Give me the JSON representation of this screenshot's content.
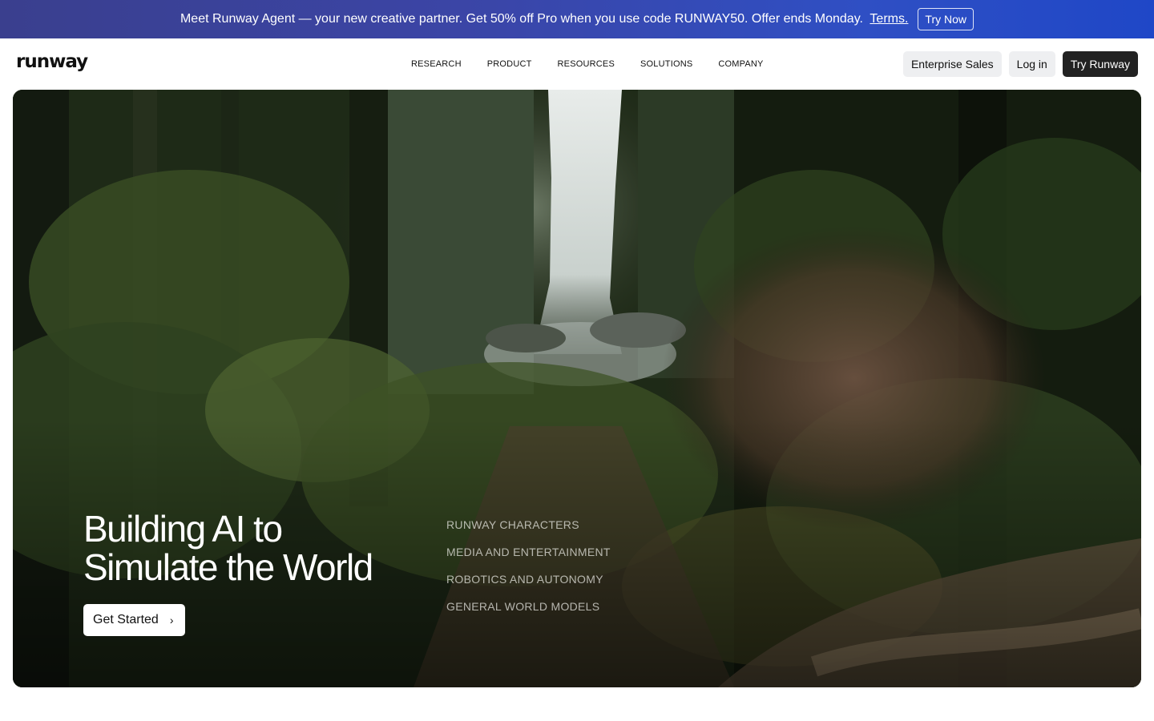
{
  "promo": {
    "text": "Meet Runway Agent — your new creative partner. Get 50% off Pro when you use code RUNWAY50. Offer ends Monday.",
    "terms_link": "Terms.",
    "cta": "Try Now"
  },
  "header": {
    "logo": "runway",
    "nav": [
      "RESEARCH",
      "PRODUCT",
      "RESOURCES",
      "SOLUTIONS",
      "COMPANY"
    ],
    "enterprise_sales": "Enterprise Sales",
    "login": "Log in",
    "try_runway": "Try Runway"
  },
  "hero": {
    "title_line1": "Building AI to",
    "title_line2": "Simulate the World",
    "cta": "Get Started",
    "cta_icon": "chevron-right-icon",
    "links": [
      "RUNWAY CHARACTERS",
      "MEDIA AND ENTERTAINMENT",
      "ROBOTICS AND AUTONOMY",
      "GENERAL WORLD MODELS"
    ]
  },
  "colors": {
    "banner_start": "#3a3f8e",
    "banner_end": "#1f47c7",
    "primary_button": "#222222",
    "secondary_button": "#eeeff1"
  }
}
